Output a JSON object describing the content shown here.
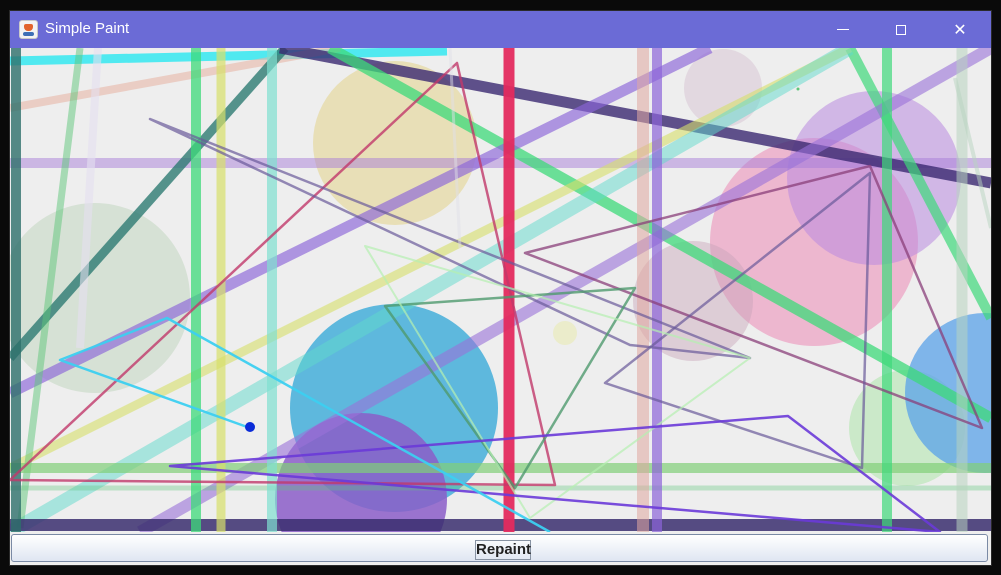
{
  "window": {
    "title": "Simple Paint",
    "icon": "java-cup-icon",
    "controls": [
      "minimize-icon",
      "maximize-icon",
      "close-icon"
    ],
    "titlebar_color": "#6b6bd6"
  },
  "canvas": {
    "background": "#eeeeee",
    "description_shapes": "random translucent circles, lines and triangles"
  },
  "toolbar": {
    "repaint_label": "Repaint"
  }
}
